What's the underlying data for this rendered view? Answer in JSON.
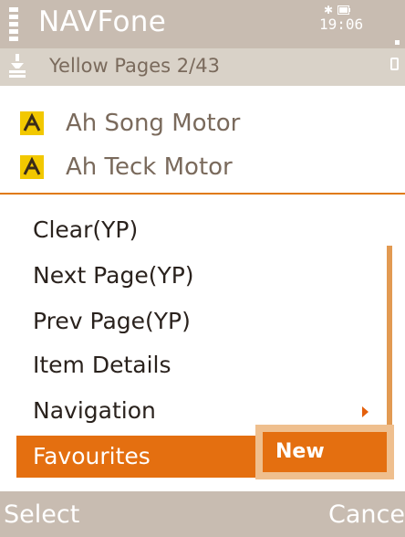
{
  "status_bar": {
    "app_title": "NAVFone",
    "clock": "19:06",
    "signal_icon": "signal-strength-icon",
    "battery_icon": "battery-icon",
    "bluetooth_icon": "bluetooth-icon"
  },
  "nav_bar": {
    "title": "Yellow Pages 2/43",
    "icon": "yellow-pages-icon"
  },
  "list": {
    "items": [
      {
        "label": "Ah Song Motor",
        "icon": "yellow-pages-icon"
      },
      {
        "label": "Ah Teck Motor",
        "icon": "yellow-pages-icon"
      }
    ]
  },
  "options_menu": {
    "items": [
      {
        "label": "Clear(YP)"
      },
      {
        "label": "Next Page(YP)"
      },
      {
        "label": "Prev Page(YP)"
      },
      {
        "label": "Item Details"
      },
      {
        "label": "Navigation",
        "has_submenu": true
      },
      {
        "label": "Favourites",
        "selected": true
      }
    ]
  },
  "submenu": {
    "items": [
      {
        "label": "New",
        "selected": true
      }
    ]
  },
  "softkeys": {
    "left": "Select",
    "right": "Cancel"
  },
  "colors": {
    "accent": "#e46f10",
    "title_bar": "#c8bcb1",
    "nav_bar": "#d9d2c8",
    "text": "#2a221d",
    "muted_text": "#7a6a5c"
  }
}
